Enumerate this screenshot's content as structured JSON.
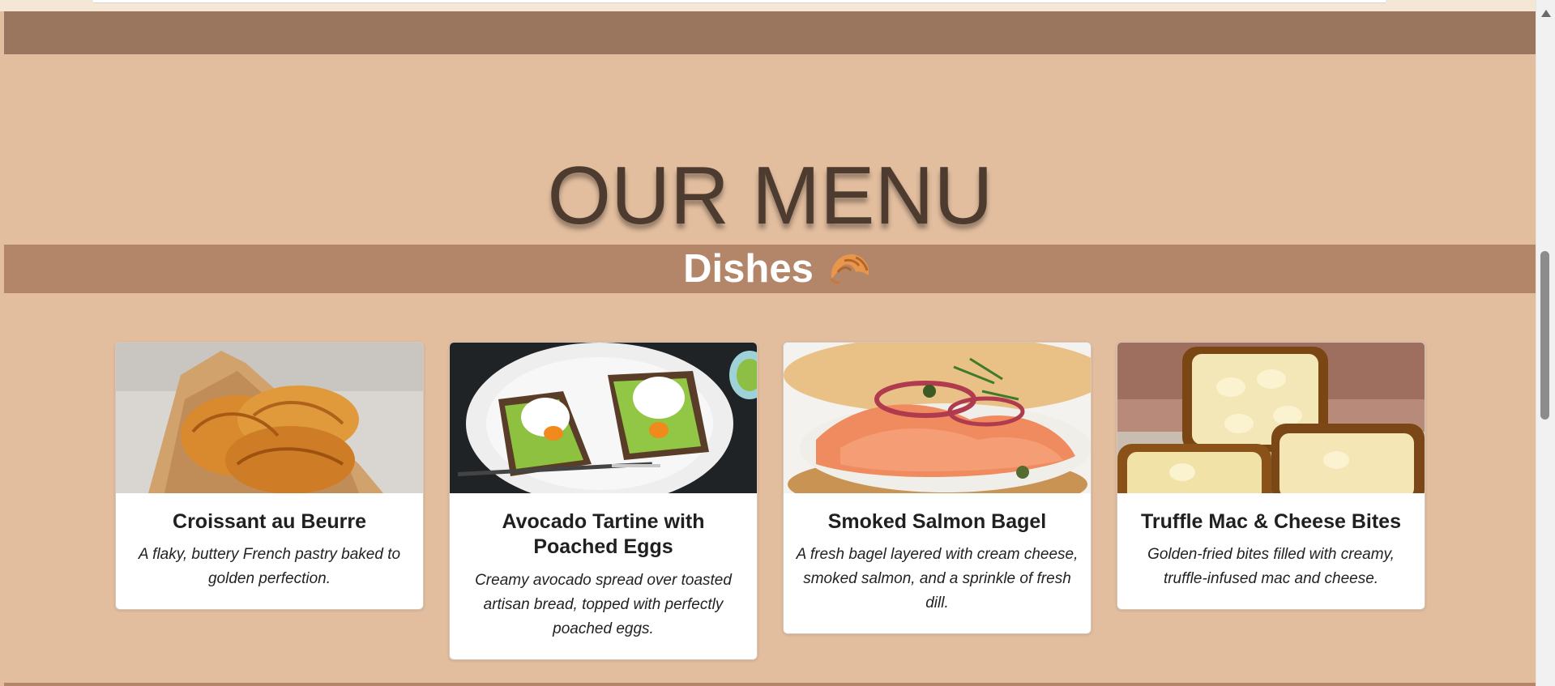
{
  "hero": {
    "title": "OUR MENU"
  },
  "section": {
    "title": "Dishes",
    "icon": "croissant-icon"
  },
  "dishes": [
    {
      "title": "Croissant au Beurre",
      "description": "A flaky, buttery French pastry baked to golden perfection.",
      "image": "croissants-on-wooden-board"
    },
    {
      "title": "Avocado Tartine with Poached Eggs",
      "description": "Creamy avocado spread over toasted artisan bread, topped with perfectly poached eggs.",
      "image": "avocado-toast-with-poached-eggs"
    },
    {
      "title": "Smoked Salmon Bagel",
      "description": "A fresh bagel layered with cream cheese, smoked salmon, and a sprinkle of fresh dill.",
      "image": "smoked-salmon-bagel"
    },
    {
      "title": "Truffle Mac & Cheese Bites",
      "description": "Golden-fried bites filled with creamy, truffle-infused mac and cheese.",
      "image": "fried-mac-and-cheese-bites"
    }
  ],
  "colors": {
    "page_background": "#e2bd9e",
    "nav_band": "#9a765e",
    "section_band": "#b38669",
    "title_text": "#4d3b2f"
  }
}
